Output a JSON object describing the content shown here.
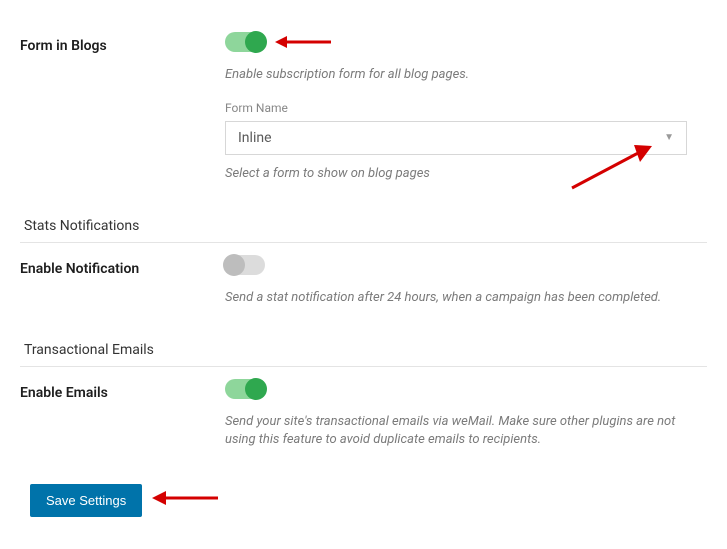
{
  "form_in_blogs": {
    "label": "Form in Blogs",
    "toggle": true,
    "helper": "Enable subscription form for all blog pages.",
    "form_name_label": "Form Name",
    "form_name_value": "Inline",
    "form_name_helper": "Select a form to show on blog pages"
  },
  "stats_notifications": {
    "header": "Stats Notifications",
    "enable_label": "Enable Notification",
    "enable_toggle": false,
    "enable_helper": "Send a stat notification after 24 hours, when a campaign has been completed."
  },
  "transactional_emails": {
    "header": "Transactional Emails",
    "enable_label": "Enable Emails",
    "enable_toggle": true,
    "enable_helper": "Send your site's transactional emails via weMail. Make sure other plugins are not using this feature to avoid duplicate emails to recipients."
  },
  "save_label": "Save Settings",
  "annotations": {
    "arrow_color": "#d40000"
  }
}
